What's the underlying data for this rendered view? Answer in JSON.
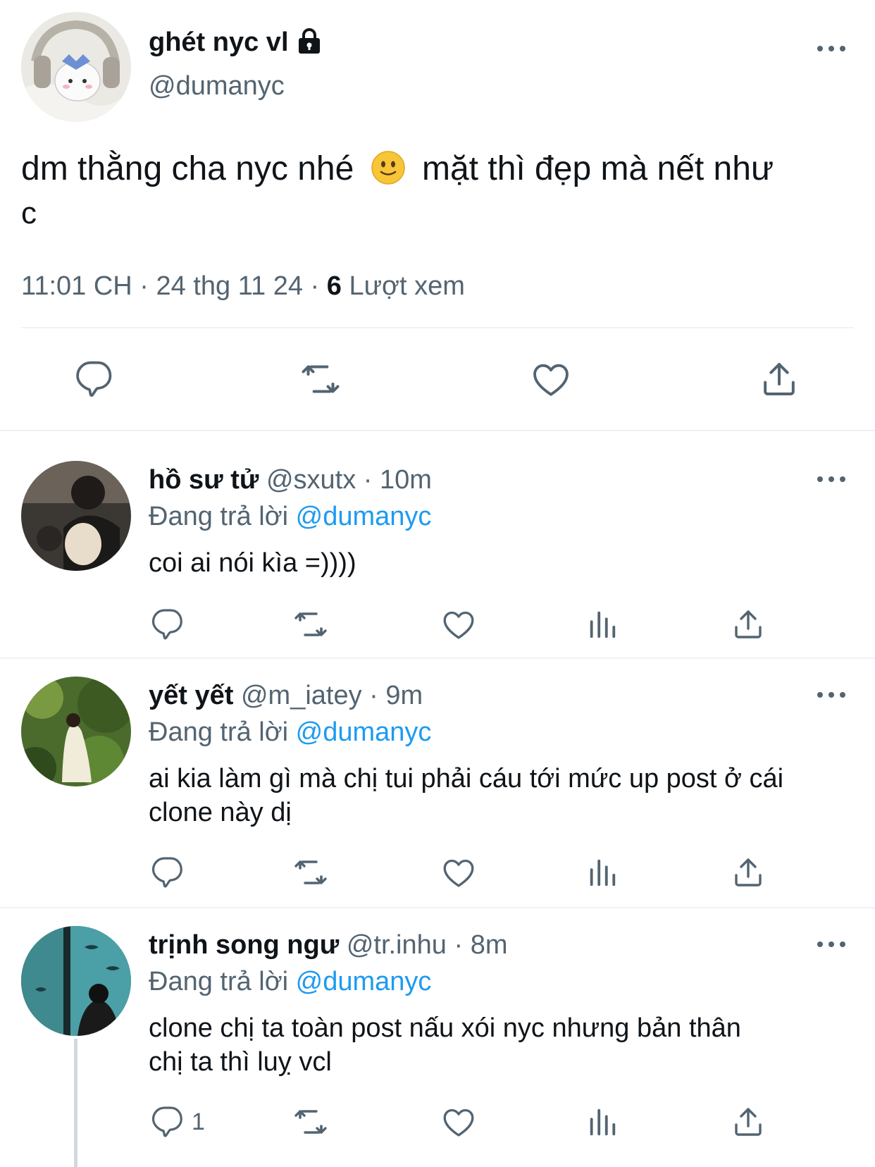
{
  "main_tweet": {
    "display_name": "ghét nyc vl",
    "handle": "@dumanyc",
    "text_part1": "dm thằng cha nyc nhé",
    "emoji": "🙂",
    "text_part2": "mặt thì đẹp mà nết như",
    "text_line2": "c",
    "time": "11:01 CH",
    "date": "24 thg 11 24",
    "views_count": "6",
    "views_label": "Lượt xem",
    "separator": "·"
  },
  "replies": [
    {
      "display_name": "hồ sư tử",
      "handle": "@sxutx",
      "time": "10m",
      "replying_label": "Đang trả lời",
      "replying_to": "@dumanyc",
      "text": "coi ai nói kìa =))))",
      "reply_count": ""
    },
    {
      "display_name": "yết yết",
      "handle": "@m_iatey",
      "time": "9m",
      "replying_label": "Đang trả lời",
      "replying_to": "@dumanyc",
      "text_line1": "ai kia làm gì mà chị tui phải cáu tới mức up post ở cái",
      "text_line2": "clone này dị",
      "reply_count": ""
    },
    {
      "display_name": "trịnh song ngư",
      "handle": "@tr.inhu",
      "time": "8m",
      "replying_label": "Đang trả lời",
      "replying_to": "@dumanyc",
      "text_line1": "clone chị ta toàn post nấu xói nyc nhưng bản thân",
      "text_line2": "chị ta thì luỵ vcl",
      "reply_count": "1"
    }
  ],
  "icons": {
    "lock": "lock-icon",
    "reply": "reply-icon",
    "retweet": "retweet-icon",
    "like": "heart-icon",
    "views": "views-icon",
    "share": "share-icon",
    "more": "more-icon"
  },
  "colors": {
    "text": "#0f1419",
    "muted": "#536471",
    "link": "#1d9bf0",
    "divider": "#eff3f4"
  }
}
